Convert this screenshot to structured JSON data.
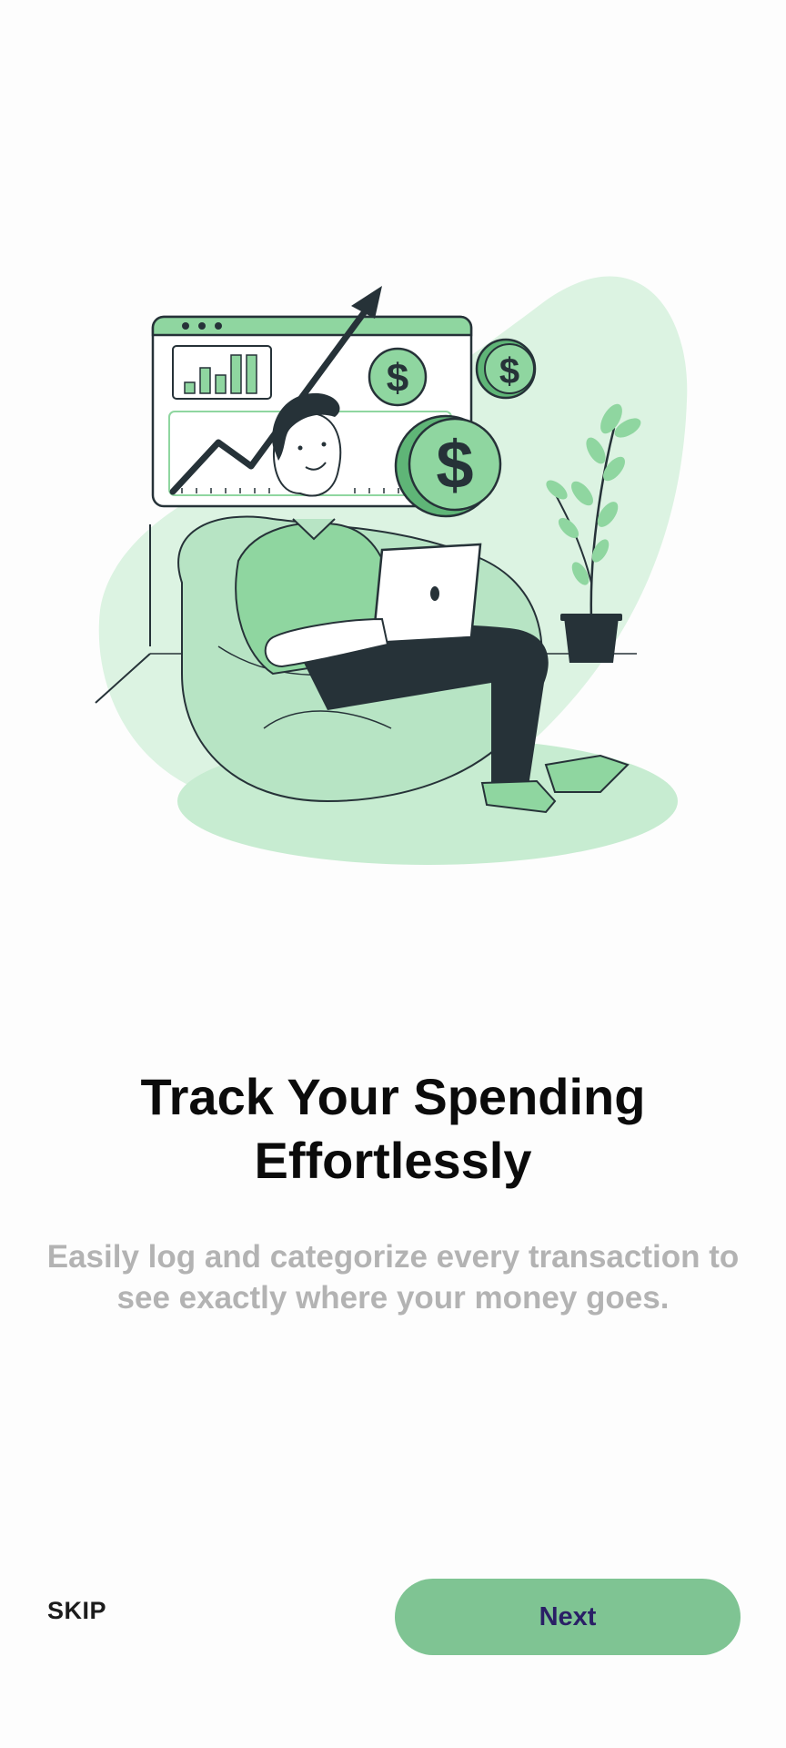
{
  "onboarding": {
    "title": "Track Your Spending Effortlessly",
    "description": "Easily log and categorize every transaction to see exactly where your money goes.",
    "illustration": "person-with-laptop-finance-illustration"
  },
  "actions": {
    "skip_label": "SKIP",
    "next_label": "Next"
  },
  "colors": {
    "background": "#fdfdfd",
    "accent": "#7fc493",
    "next_text": "#2a1f66",
    "title_text": "#0b0b0b",
    "subtitle_text": "#b3b3b3",
    "dark": "#263238"
  }
}
